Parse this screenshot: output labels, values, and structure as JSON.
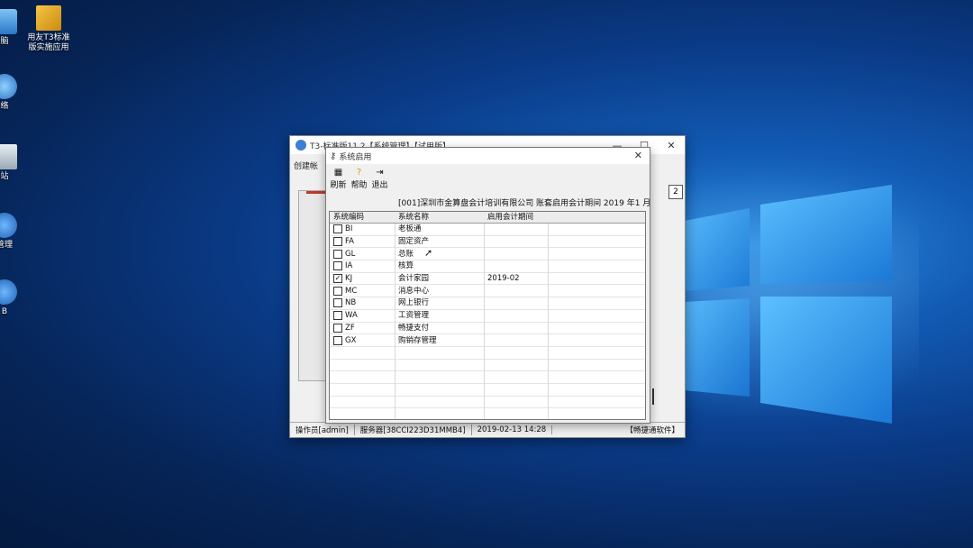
{
  "desktop": {
    "icons": [
      {
        "label": "脑",
        "icon": "computer-icon"
      },
      {
        "label": "用友T3标准\n版实施应用",
        "icon": "file-folder-icon"
      },
      {
        "label": "络",
        "icon": "network-icon"
      },
      {
        "label": "站",
        "icon": "recycle-bin-icon"
      },
      {
        "label": "管理",
        "icon": "app-icon"
      },
      {
        "label": "B",
        "icon": "app-icon"
      }
    ]
  },
  "main_window": {
    "title": "T3-标准版11.2【系统管理】【试用版】",
    "menu": "创建帐",
    "right_box": "2",
    "status": {
      "operator": "操作员[admin]",
      "server": "服务器[38CCI223D31MMB4]",
      "datetime": "2019-02-13  14:28",
      "vendor": "【畅捷通软件】"
    }
  },
  "dialog": {
    "title": "系统启用",
    "toolbar": {
      "refresh": "刷新",
      "help": "帮助",
      "exit": "退出"
    },
    "info": "[001]深圳市金算盘会计培训有限公司 账套启用会计期间 2019 年1 月",
    "columns": [
      "系统编码",
      "系统名称",
      "启用会计期间",
      ""
    ],
    "rows": [
      {
        "code": "BI",
        "name": "老板通",
        "period": "",
        "checked": false
      },
      {
        "code": "FA",
        "name": "固定资产",
        "period": "",
        "checked": false
      },
      {
        "code": "GL",
        "name": "总账",
        "period": "",
        "checked": false
      },
      {
        "code": "IA",
        "name": "核算",
        "period": "",
        "checked": false
      },
      {
        "code": "KJ",
        "name": "会计家园",
        "period": "2019-02",
        "checked": true
      },
      {
        "code": "MC",
        "name": "消息中心",
        "period": "",
        "checked": false
      },
      {
        "code": "NB",
        "name": "网上银行",
        "period": "",
        "checked": false
      },
      {
        "code": "WA",
        "name": "工资管理",
        "period": "",
        "checked": false
      },
      {
        "code": "ZF",
        "name": "畅捷支付",
        "period": "",
        "checked": false
      },
      {
        "code": "GX",
        "name": "购销存管理",
        "period": "",
        "checked": false
      }
    ]
  }
}
